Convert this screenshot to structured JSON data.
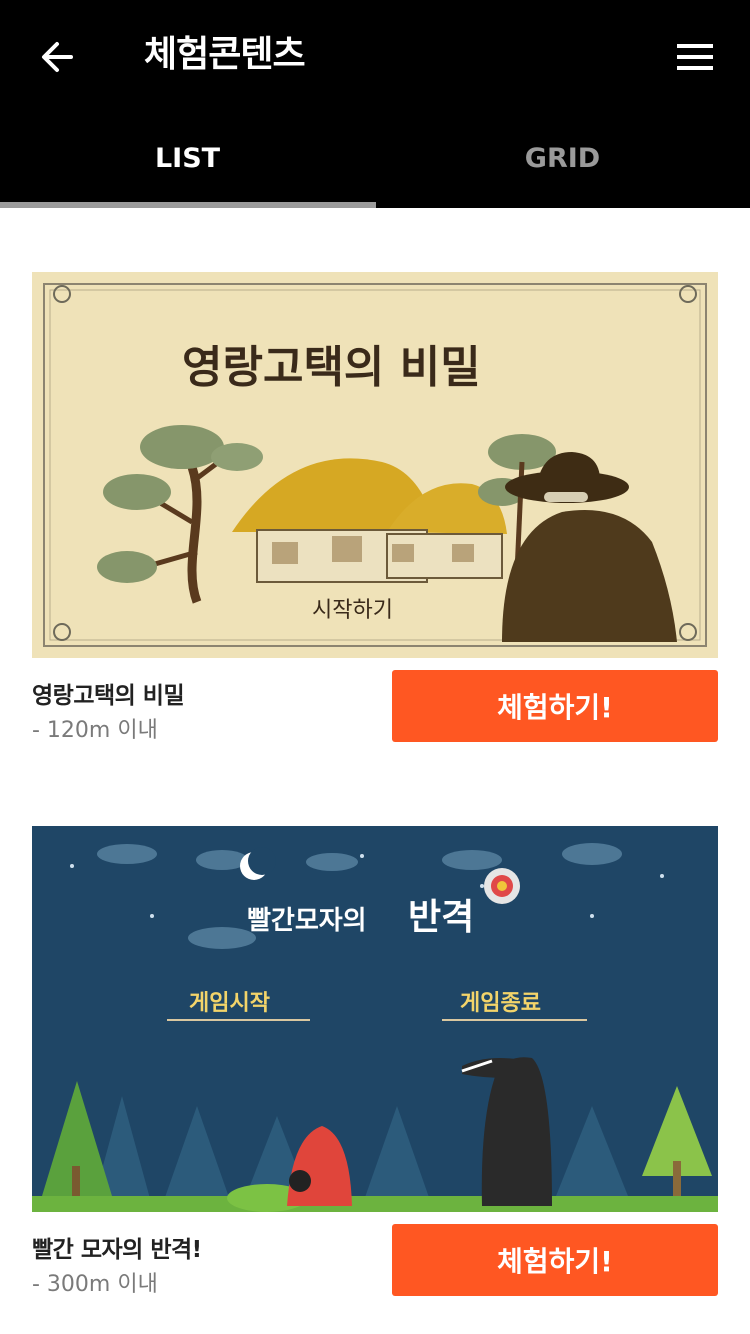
{
  "header": {
    "title": "체험콘텐츠",
    "back_icon": "arrow-left-icon",
    "menu_icon": "hamburger-menu-icon"
  },
  "tabs": [
    {
      "label": "LIST",
      "active": true
    },
    {
      "label": "GRID",
      "active": false
    }
  ],
  "colors": {
    "header_bg": "#000000",
    "accent": "#ff5722",
    "tab_indicator": "#9b9b9b"
  },
  "items": [
    {
      "image_title": "영랑고택의 비밀",
      "image_start": "시작하기",
      "title": "영랑고택의 비밀",
      "distance": "- 120m 이내",
      "button": "체험하기!"
    },
    {
      "image_title_small": "빨간모자의",
      "image_title_big": "반격",
      "image_start": "게임시작",
      "image_end": "게임종료",
      "title": "빨간 모자의 반격!",
      "distance": "- 300m 이내",
      "button": "체험하기!"
    }
  ]
}
